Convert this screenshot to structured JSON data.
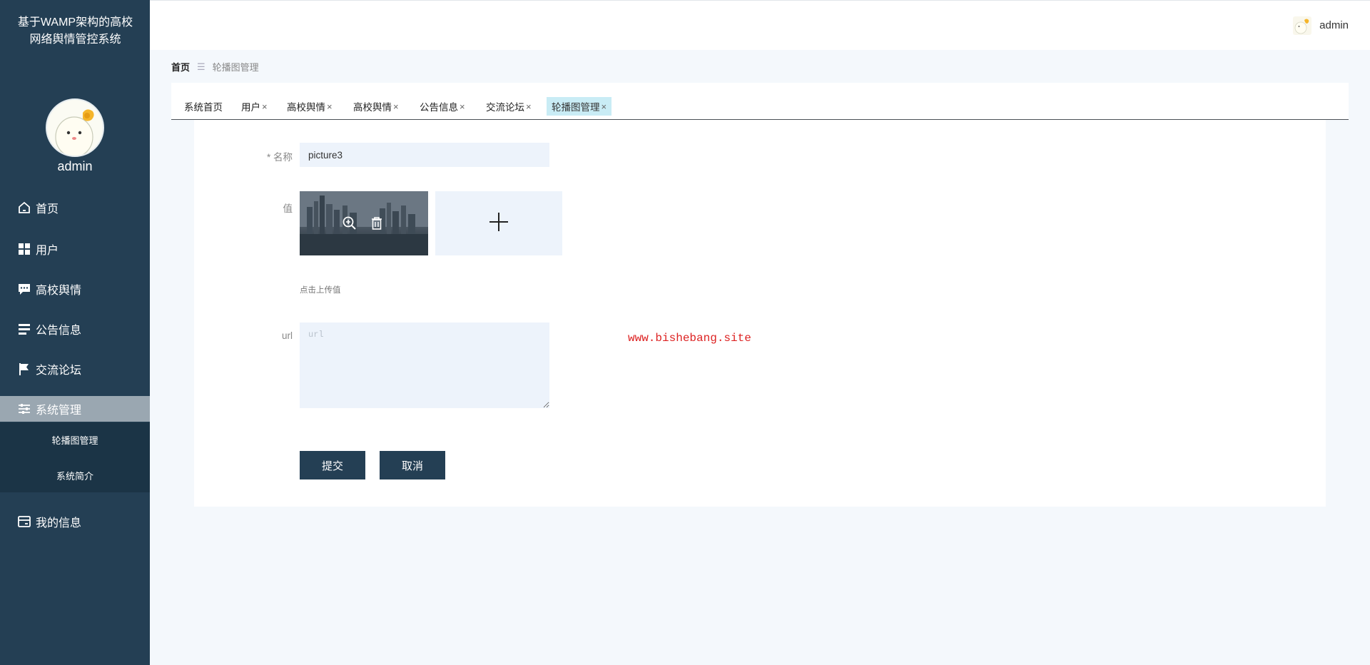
{
  "app": {
    "title": "基于WAMP架构的高校网络舆情管控系统"
  },
  "profile": {
    "name": "admin"
  },
  "topbar": {
    "username": "admin"
  },
  "sidebar": {
    "items": [
      {
        "label": "首页",
        "icon": "home-icon"
      },
      {
        "label": "用户",
        "icon": "grid-icon"
      },
      {
        "label": "高校舆情",
        "icon": "chat-icon"
      },
      {
        "label": "公告信息",
        "icon": "list-icon"
      },
      {
        "label": "交流论坛",
        "icon": "flag-icon"
      },
      {
        "label": "系统管理",
        "icon": "sliders-icon",
        "active": true
      },
      {
        "label": "我的信息",
        "icon": "card-icon"
      }
    ],
    "submenu": [
      {
        "label": "轮播图管理"
      },
      {
        "label": "系统简介"
      }
    ]
  },
  "breadcrumb": {
    "home": "首页",
    "separator": "☰",
    "current": "轮播图管理"
  },
  "tabs": [
    {
      "label": "系统首页",
      "closable": false
    },
    {
      "label": "用户",
      "closable": true
    },
    {
      "label": "高校舆情",
      "closable": true
    },
    {
      "label": "高校舆情",
      "closable": true
    },
    {
      "label": "公告信息",
      "closable": true
    },
    {
      "label": "交流论坛",
      "closable": true
    },
    {
      "label": "轮播图管理",
      "closable": true,
      "active": true
    }
  ],
  "tab_close_symbol": "×",
  "form": {
    "name_label": "* 名称",
    "name_value": "picture3",
    "value_label": "值",
    "upload_hint": "点击上传值",
    "url_label": "url",
    "url_placeholder": "url",
    "submit_label": "提交",
    "cancel_label": "取消"
  },
  "watermark": "www.bishebang.site",
  "colors": {
    "sidebar": "#243f54",
    "active_tab": "#c9ecf5",
    "input_bg": "#edf3fb",
    "watermark": "#dd2222"
  }
}
